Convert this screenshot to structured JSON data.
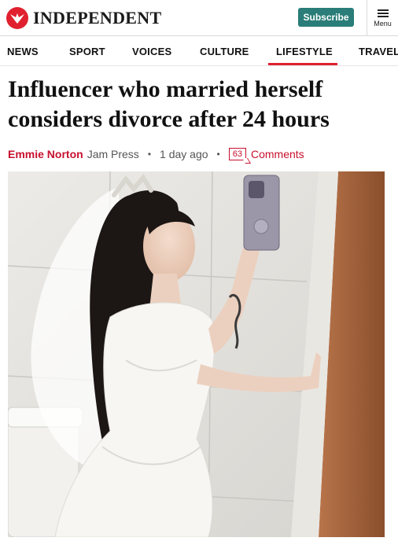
{
  "header": {
    "brand": "INDEPENDENT",
    "subscribe_label": "Subscribe",
    "menu_label": "Menu",
    "logo_icon": "eagle-icon",
    "menu_icon": "hamburger-icon"
  },
  "nav": {
    "items": [
      {
        "label": "NEWS"
      },
      {
        "label": "SPORT"
      },
      {
        "label": "VOICES"
      },
      {
        "label": "CULTURE"
      },
      {
        "label": "LIFESTYLE",
        "active": true
      },
      {
        "label": "TRAVEL"
      }
    ]
  },
  "article": {
    "headline_line1": "Influencer who married herself",
    "headline_line2": "considers divorce after 24 hours",
    "author": "Emmie Norton",
    "source": "Jam Press",
    "date": "1 day ago",
    "comment_count": "63",
    "comments_label": "Comments"
  },
  "colors": {
    "brand_red": "#e0202e",
    "subscribe_teal": "#2a7d78",
    "byline_red": "#c8102e"
  }
}
